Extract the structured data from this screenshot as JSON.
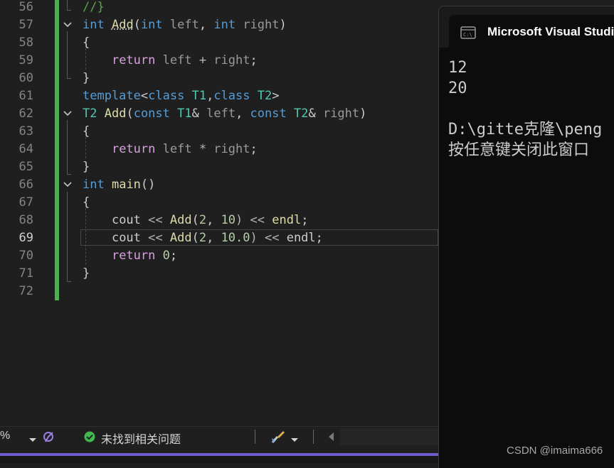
{
  "editor": {
    "line_numbers": [
      "56",
      "57",
      "58",
      "59",
      "60",
      "61",
      "62",
      "63",
      "64",
      "65",
      "66",
      "67",
      "68",
      "69",
      "70",
      "71",
      "72"
    ],
    "active_line": "69",
    "code": {
      "l56": "//}",
      "l57": {
        "t1": "int",
        "t2": "Add",
        "t3": "(",
        "t4": "int",
        "t5": "left",
        "t6": ", ",
        "t7": "int",
        "t8": "right",
        "t9": ")"
      },
      "l58": "{",
      "l59": {
        "t1": "return",
        "t2": "left",
        "t3": " + ",
        "t4": "right",
        "t5": ";"
      },
      "l60": "}",
      "l61": {
        "t1": "template",
        "t2": "<",
        "t3": "class",
        "t4": "T1",
        "t5": ",",
        "t6": "class",
        "t7": "T2",
        "t8": ">"
      },
      "l62": {
        "t1": "T2",
        "t2": "Add",
        "t3": "(",
        "t4": "const",
        "t5": "T1",
        "t6": "& ",
        "t7": "left",
        "t8": ", ",
        "t9": "const",
        "t10": "T2",
        "t11": "& ",
        "t12": "right",
        "t13": ")"
      },
      "l63": "{",
      "l64": {
        "t1": "return",
        "t2": "left",
        "t3": " * ",
        "t4": "right",
        "t5": ";"
      },
      "l65": "}",
      "l66": {
        "t1": "int",
        "t2": "main",
        "t3": "()"
      },
      "l67": "{",
      "l68": {
        "t1": "cout",
        "t2": " << ",
        "t3": "Add",
        "t4": "(",
        "t5": "2",
        "t6": ", ",
        "t7": "10",
        "t8": ") << ",
        "t9": "endl",
        "t10": ";"
      },
      "l69": {
        "t1": "cout",
        "t2": " << ",
        "t3": "Add",
        "t4": "(",
        "t5": "2",
        "t6": ", ",
        "t7": "10.0",
        "t8": ") << ",
        "t9": "endl",
        "t10": ";"
      },
      "l70": {
        "t1": "return",
        "t2": "0",
        "t3": ";"
      },
      "l71": "}"
    }
  },
  "statusbar": {
    "zoom": "%",
    "zoom_icon": "chevron-down-icon",
    "issues_icon": "check-circle-icon",
    "issues_text": "未找到相关问题",
    "tool_icon": "brush-icon",
    "scroll_icon": "triangle-left-icon"
  },
  "console": {
    "title": "Microsoft Visual Studi",
    "icon": "console-icon",
    "lines": [
      "12",
      "20",
      "",
      "D:\\gitte克隆\\peng",
      "按任意键关闭此窗口"
    ]
  },
  "watermark": "CSDN @imaima666",
  "colors": {
    "editor_bg": "#1f1f1f",
    "keyword": "#569cd6",
    "control": "#d8a0df",
    "type": "#4ec9b0",
    "function": "#dcdcaa",
    "number": "#b5cea8",
    "comment": "#57a64a",
    "change_bar": "#4caf50",
    "accent": "#6b5fd0",
    "console_bg": "#0c0c0c"
  }
}
